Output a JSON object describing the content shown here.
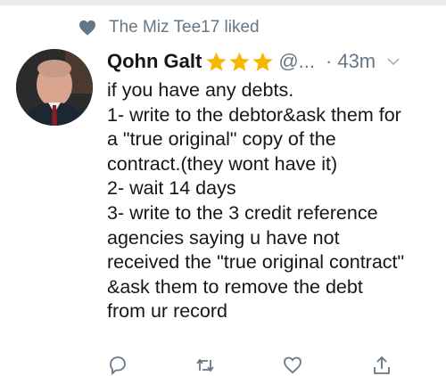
{
  "social_context": {
    "icon": "heart-icon",
    "text": "The Miz Tee17 liked"
  },
  "tweet": {
    "author_name": "Qohn Galt",
    "stars_icon": "star-icon",
    "handle": "@...",
    "separator": "·",
    "time": "43m",
    "caret_icon": "chevron-down-icon",
    "lines": [
      "if you have any debts.",
      "1- write to the debtor&ask them for",
      "a \"true original\" copy of the",
      "contract.(they wont have it)",
      "2- wait 14 days",
      "3- write to the 3 credit reference",
      "agencies saying u have not",
      "received the \"true original contract\"",
      "&ask them to remove the debt",
      "from ur record"
    ]
  },
  "actions": [
    {
      "icon": "reply-icon"
    },
    {
      "icon": "retweet-icon"
    },
    {
      "icon": "like-icon"
    },
    {
      "icon": "share-icon"
    }
  ],
  "colors": {
    "text_primary": "#14171a",
    "text_secondary": "#657786",
    "star": "#f5b800",
    "divider": "#e6ecf0"
  }
}
